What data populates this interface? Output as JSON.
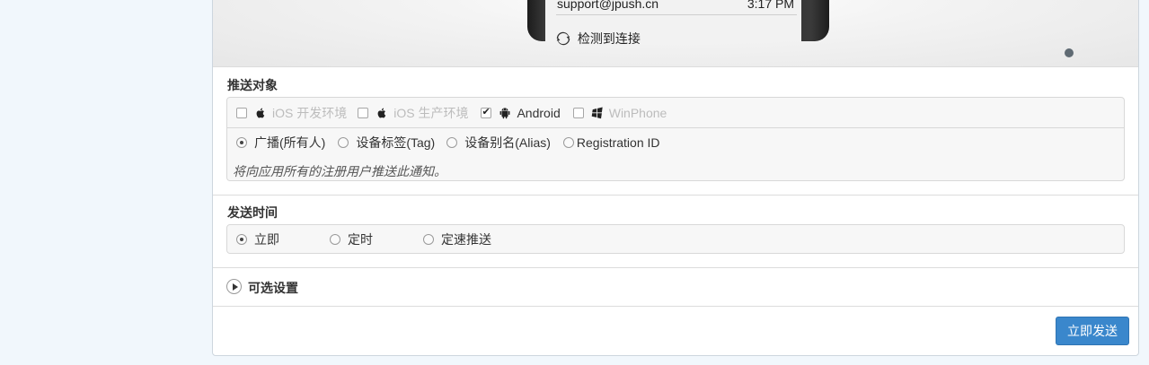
{
  "preview": {
    "email": "support@jpush.cn",
    "time": "3:17 PM",
    "status": "检测到连接"
  },
  "target": {
    "title": "推送对象",
    "platforms": [
      {
        "label": "iOS 开发环境",
        "checked": false,
        "disabled": true,
        "icon": "apple-icon"
      },
      {
        "label": "iOS 生产环境",
        "checked": false,
        "disabled": true,
        "icon": "apple-icon"
      },
      {
        "label": "Android",
        "checked": true,
        "disabled": false,
        "icon": "android-icon"
      },
      {
        "label": "WinPhone",
        "checked": false,
        "disabled": true,
        "icon": "windows-icon"
      }
    ],
    "audience": [
      {
        "label": "广播(所有人)",
        "selected": true
      },
      {
        "label": "设备标签(Tag)",
        "selected": false
      },
      {
        "label": "设备别名(Alias)",
        "selected": false
      },
      {
        "label": "Registration ID",
        "selected": false
      }
    ],
    "hint": "将向应用所有的注册用户推送此通知。"
  },
  "schedule": {
    "title": "发送时间",
    "options": [
      {
        "label": "立即",
        "selected": true
      },
      {
        "label": "定时",
        "selected": false
      },
      {
        "label": "定速推送",
        "selected": false
      }
    ]
  },
  "optional": {
    "title": "可选设置"
  },
  "actions": {
    "submit_label": "立即发送"
  },
  "colors": {
    "background": "#f1f7fc",
    "primary_button": "#3a87cc"
  }
}
